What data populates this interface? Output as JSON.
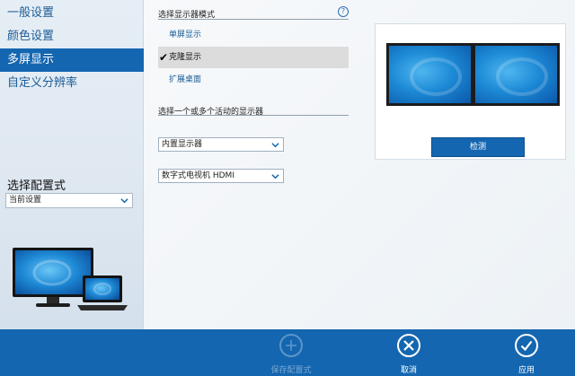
{
  "sidebar": {
    "items": [
      {
        "label": "一般设置"
      },
      {
        "label": "颜色设置"
      },
      {
        "label": "多屏显示"
      },
      {
        "label": "自定义分辨率"
      }
    ],
    "active_index": 2,
    "profile_label": "选择配置式",
    "profile_value": "当前设置"
  },
  "main": {
    "mode_title": "选择显示器模式",
    "modes": [
      {
        "label": "单屏显示"
      },
      {
        "label": "克隆显示"
      },
      {
        "label": "扩展桌面"
      }
    ],
    "selected_mode_index": 1,
    "displays_title": "选择一个或多个活动的显示器",
    "display_1": "内置显示器",
    "display_2": "数字式电视机 HDMI",
    "help_glyph": "?"
  },
  "preview": {
    "detect_label": "检测"
  },
  "footer": {
    "save_label": "保存配置式",
    "cancel_label": "取消",
    "apply_label": "应用"
  },
  "colors": {
    "accent": "#1466b0",
    "link": "#1b5c96"
  },
  "icons": {
    "check": "✔",
    "save": "plus-icon",
    "cancel": "close-icon",
    "apply": "check-icon"
  }
}
